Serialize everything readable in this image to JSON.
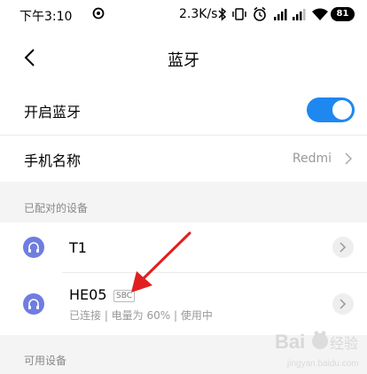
{
  "status_bar": {
    "time": "下午3:10",
    "speed": "2.3K/s",
    "battery": "81"
  },
  "header": {
    "title": "蓝牙"
  },
  "settings": {
    "bluetooth_toggle_label": "开启蓝牙",
    "bluetooth_on": true,
    "device_name_label": "手机名称",
    "device_name_value": "Redmi"
  },
  "paired": {
    "section_title": "已配对的设备",
    "devices": [
      {
        "name": "T1",
        "icon": "headphone-icon"
      },
      {
        "name": "HE05",
        "codec": "SBC",
        "status": "已连接 | 电量为 60% | 使用中",
        "icon": "headphone-icon"
      }
    ]
  },
  "available": {
    "section_title": "可用设备"
  },
  "colors": {
    "accent": "#1e88f0",
    "device_icon": "#6f7de0",
    "annotation_arrow": "#e02020"
  },
  "watermark_text": "Baidu 经验 jingyan.baidu.com"
}
